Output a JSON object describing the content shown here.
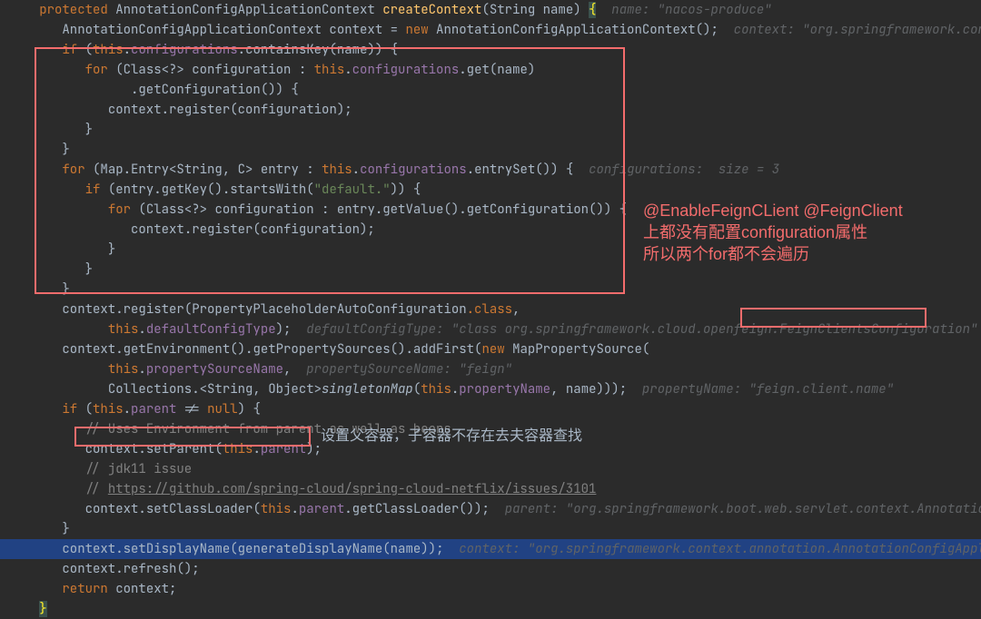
{
  "lines": {
    "l1_protected": "protected",
    "l1_type": "AnnotationConfigApplicationContext",
    "l1_method": "createContext",
    "l1_paramtype": "String",
    "l1_param": "name",
    "l1_hint": "name: \"nacos-produce\"",
    "l2_type": "AnnotationConfigApplicationContext",
    "l2_var": "context",
    "l2_new": "new",
    "l2_ctor": "AnnotationConfigApplicationContext",
    "l2_hint": "context: \"org.springframework.context.anno",
    "l3_if": "if",
    "l3_this": "this",
    "l3_field": "configurations",
    "l3_fn": "containsKey",
    "l3_arg": "name",
    "l4_for": "for",
    "l4_type": "Class<?>",
    "l4_var": "configuration",
    "l4_this": "this",
    "l4_field": "configurations",
    "l4_get": "get",
    "l4_arg": "name",
    "l5_fn": "getConfiguration",
    "l6_ctx": "context",
    "l6_reg": "register",
    "l6_arg": "configuration",
    "l9_for": "for",
    "l9_type1": "Map.Entry<",
    "l9_type2": "String",
    "l9_type3": ", ",
    "l9_type4": "C",
    "l9_type5": ">",
    "l9_var": "entry",
    "l9_this": "this",
    "l9_field": "configurations",
    "l9_fn": "entrySet",
    "l9_hint": "configurations:  size = 3",
    "l10_if": "if",
    "l10_e": "entry",
    "l10_gk": "getKey",
    "l10_sw": "startsWith",
    "l10_str": "\"default.\"",
    "l11_for": "for",
    "l11_type": "Class<?>",
    "l11_var": "configuration",
    "l11_e": "entry",
    "l11_gv": "getValue",
    "l11_gc": "getConfiguration",
    "l12_ctx": "context",
    "l12_reg": "register",
    "l12_arg": "configuration",
    "l16_ctx": "context",
    "l16_reg": "register",
    "l16_cls": "PropertyPlaceholderAutoConfiguration",
    "l16_class": ".class",
    "l17_this": "this",
    "l17_field": "defaultConfigType",
    "l17_hint": "defaultConfigType: \"class org.springframework.cloud.openfeign.",
    "l17_hint2": "FeignClientsConfiguration",
    "l18_ctx": "context",
    "l18_ge": "getEnvironment",
    "l18_gps": "getPropertySources",
    "l18_af": "addFirst",
    "l18_new": "new",
    "l18_mps": "MapPropertySource",
    "l19_this": "this",
    "l19_field": "propertySourceName",
    "l19_hint": "propertySourceName: \"feign\"",
    "l20_coll": "Collections.<",
    "l20_str": "String",
    "l20_obj": ", Object>",
    "l20_sm": "singletonMap",
    "l20_this": "this",
    "l20_field": "propertyName",
    "l20_name": "name",
    "l20_hint": "propertyName: \"feign.client.name\"",
    "l21_if": "if",
    "l21_this": "this",
    "l21_parent": "parent",
    "l21_ne": "!= ",
    "l21_null": "null",
    "l22_cmt": "// Uses Environment from parent as well as beans",
    "l23_ctx": "context",
    "l23_sp": "setParent",
    "l23_this": "this",
    "l23_parent": "parent",
    "l24_cmt": "// jdk11 issue",
    "l25_cmt1": "// ",
    "l25_cmt2": "https://github.com/spring-cloud/spring-cloud-netflix/issues/3101",
    "l26_ctx": "context",
    "l26_scl": "setClassLoader",
    "l26_this": "this",
    "l26_parent": "parent",
    "l26_gcl": "getClassLoader",
    "l26_hint": "parent: \"org.springframework.boot.web.servlet.context.AnnotationConfigS",
    "l28_ctx": "context",
    "l28_sdn": "setDisplayName",
    "l28_gdn": "generateDisplayName",
    "l28_name": "name",
    "l28_hint": "context: \"org.springframework.context.annotation.AnnotationConfigApplicationCo",
    "l29_ctx": "context",
    "l29_ref": "refresh",
    "l30_ret": "return",
    "l30_ctx": "context"
  },
  "annotations": {
    "right_l1": "@EnableFeignCLient @FeignClient",
    "right_l2": "上都没有配置configuration属性",
    "right_l3": "所以两个for都不会遍历",
    "setParent_cn": "设置父容器，子容器不存在去夫容器查找"
  }
}
